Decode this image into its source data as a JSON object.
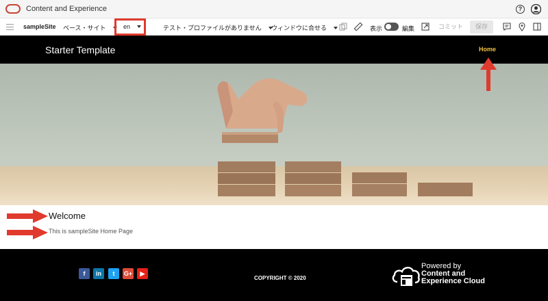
{
  "app": {
    "title": "Content and Experience"
  },
  "toolbar": {
    "site_name": "sampleSite",
    "base_site_label": "ベース・サイト",
    "language": "en",
    "test_profile_label": "テスト・プロファイルがありません",
    "fit_window_label": "ウィンドウに合せる",
    "view_label": "表示",
    "edit_label": "編集",
    "commit_label": "コミット",
    "save_label": "保存"
  },
  "site": {
    "title": "Starter Template",
    "nav_home": "Home"
  },
  "welcome": {
    "heading": "Welcome",
    "text": "This is sampleSite Home Page"
  },
  "footer": {
    "social": [
      "f",
      "in",
      "t",
      "G+",
      "▶"
    ],
    "copyright": "COPYRIGHT © 2020",
    "powered_line1": "Powered by",
    "powered_line2": "Content and",
    "powered_line3": "Experience Cloud"
  },
  "colors": {
    "oracle_red": "#c74634",
    "annotation_red": "#e03a2e",
    "nav_gold": "#f0c040",
    "facebook": "#3b5998",
    "linkedin": "#0e76a8",
    "twitter": "#1da1f2",
    "googleplus": "#dd4b39",
    "youtube": "#e62117"
  },
  "icons": [
    "oracle-logo",
    "help-icon",
    "user-icon",
    "hamburger-icon",
    "copy-icon",
    "ruler-icon",
    "open-external-icon",
    "comment-icon",
    "location-pin-icon",
    "side-panel-icon"
  ]
}
